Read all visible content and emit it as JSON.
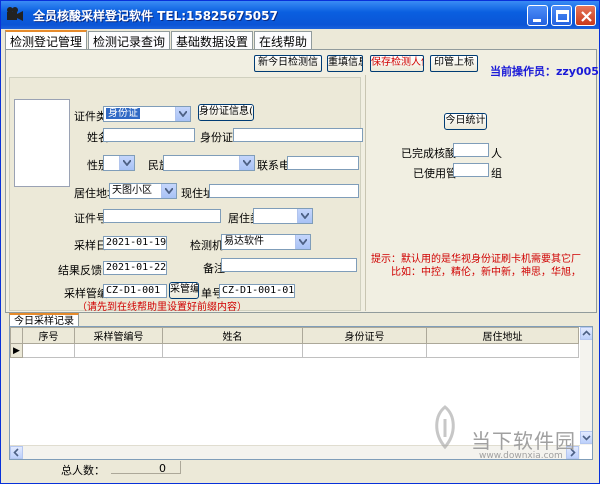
{
  "window": {
    "title": "全员核酸采样登记软件 TEL:15825675057"
  },
  "menu_tabs": [
    {
      "label": "检测登记管理",
      "active": true
    },
    {
      "label": "检测记录查询",
      "active": false
    },
    {
      "label": "基础数据设置",
      "active": false
    },
    {
      "label": "在线帮助",
      "active": false
    }
  ],
  "toolbar": {
    "btn_new": "新今日检测信",
    "btn_fill": "重填信息",
    "btn_save": "保存检测人信",
    "btn_print": "印管上标",
    "operator_label": "当前操作员：",
    "operator_value": "zzy005"
  },
  "form": {
    "id_type_label": "证件类",
    "id_type_value": "身份证",
    "read_id_button": "身份证信息(",
    "name_label": "姓名",
    "id_card_label": "身份证",
    "gender_label": "性别",
    "ethnic_label": "民族",
    "phone_label": "联系电",
    "address_label": "居住地址",
    "address_value": "天图小区",
    "current_label": "现住址",
    "cert_no_label": "证件号",
    "residence_type_label": "居住类",
    "sample_date_label": "采样日",
    "sample_date_value": "2021-01-19",
    "agency_label": "检测机",
    "agency_value": "易达软件",
    "result_date_label": "结果反馈",
    "result_date_value": "2021-01-22",
    "remark_label": "备注",
    "tube_label": "采样管编",
    "tube_value": "CZ-D1-001",
    "tube_button": "采管编号",
    "single_label": "单号",
    "single_value": "CZ-D1-001-01",
    "note": "（请先到在线帮助里设置好前缀内容）"
  },
  "right": {
    "today_stats_button": "今日统计",
    "done_label": "已完成核酸",
    "done_unit": "人",
    "used_label": "已使用管",
    "used_unit": "组",
    "hint_line1": "提示：默认用的是华视身份证刷卡机需要其它厂",
    "hint_line2": "比如：中控，精伦，新中新，神思，华旭，"
  },
  "records": {
    "tab_label": "今日采样记录",
    "columns": [
      "序号",
      "采样管编号",
      "姓名",
      "身份证号",
      "居住地址"
    ],
    "row_indicator": "▶",
    "total_label": "总人数：",
    "total_value": "0"
  },
  "watermark": {
    "text": "当下软件园",
    "url": "www.downxia.com"
  },
  "colors": {
    "title_blue": "#0b55d6",
    "hint_red": "#d00000",
    "operator_blue": "#1a1ad8",
    "tab_accent": "#e68b2c"
  }
}
